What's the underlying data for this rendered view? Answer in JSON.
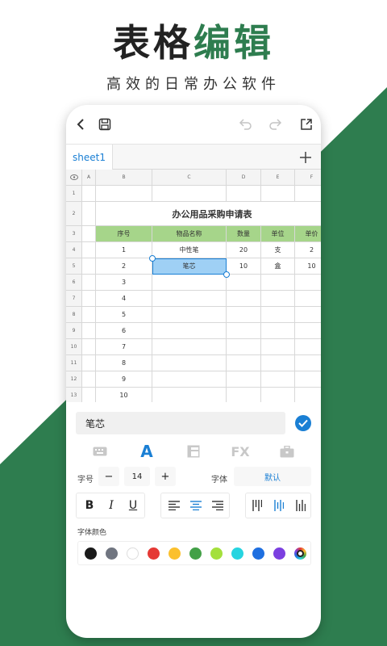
{
  "promo": {
    "title_part1": "表格",
    "title_part2": "编辑",
    "subtitle": "高效的日常办公软件"
  },
  "colors": {
    "brand_green": "#2e7d4f",
    "accent_blue": "#1a7fd4",
    "header_green": "#a6d58a",
    "selection_blue": "#9fd0f5"
  },
  "toolbar": {
    "icons": [
      "back-icon",
      "save-icon",
      "undo-icon",
      "redo-icon",
      "share-icon"
    ]
  },
  "tabs": {
    "sheet": "sheet1",
    "add": "+"
  },
  "sheet": {
    "columns": [
      "A",
      "B",
      "C",
      "D",
      "E",
      "F"
    ],
    "rows": [
      "1",
      "2",
      "3",
      "4",
      "5",
      "6",
      "7",
      "8",
      "9",
      "10",
      "11",
      "12",
      "13"
    ],
    "title": "办公用品采购申请表",
    "headers": [
      "序号",
      "物品名称",
      "数量",
      "单位",
      "单价"
    ],
    "data": [
      [
        "1",
        "中性笔",
        "20",
        "支",
        "2"
      ],
      [
        "2",
        "笔芯",
        "10",
        "盒",
        "10"
      ],
      [
        "3",
        "",
        "",
        "",
        ""
      ],
      [
        "4",
        "",
        "",
        "",
        ""
      ],
      [
        "5",
        "",
        "",
        "",
        ""
      ],
      [
        "6",
        "",
        "",
        "",
        ""
      ],
      [
        "7",
        "",
        "",
        "",
        ""
      ],
      [
        "8",
        "",
        "",
        "",
        ""
      ],
      [
        "9",
        "",
        "",
        "",
        ""
      ],
      [
        "10",
        "",
        "",
        "",
        ""
      ]
    ]
  },
  "editor": {
    "value": "笔芯"
  },
  "format": {
    "font_size_label": "字号",
    "font_size": "14",
    "minus": "−",
    "plus": "+",
    "font_label": "字体",
    "font_value": "默认",
    "bold": "B",
    "italic": "I",
    "underline": "U",
    "color_label": "字体颜色",
    "swatches": [
      "#1a1a1a",
      "#707580",
      "#ffffff",
      "#e53935",
      "#fbc02d",
      "#43a047",
      "#a4e03c",
      "#26d4e0",
      "#1e6fe0",
      "#7b3fe0"
    ]
  }
}
